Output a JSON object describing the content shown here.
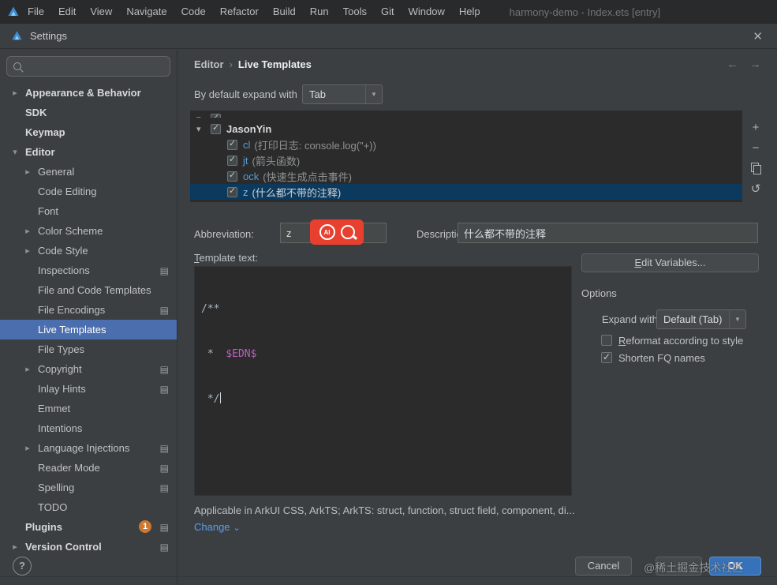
{
  "menu_bar": {
    "items": [
      "File",
      "Edit",
      "View",
      "Navigate",
      "Code",
      "Refactor",
      "Build",
      "Run",
      "Tools",
      "Git",
      "Window",
      "Help"
    ],
    "window_title": "harmony-demo - Index.ets [entry]"
  },
  "dialog": {
    "title": "Settings"
  },
  "icons": {
    "close": "✕",
    "chevron_collapsed": "▸",
    "chevron_expanded": "▾",
    "combo_arrow": "▼",
    "back": "←",
    "forward": "→",
    "breadcrumb_sep": "›",
    "tree_item": "▤",
    "add": "+",
    "remove": "−",
    "revert": "↺",
    "change_caret": "⌄",
    "help": "?"
  },
  "sidebar": {
    "items": [
      {
        "label": "Appearance & Behavior"
      },
      {
        "label": "SDK"
      },
      {
        "label": "Keymap"
      },
      {
        "label": "Editor"
      },
      {
        "label": "General"
      },
      {
        "label": "Code Editing"
      },
      {
        "label": "Font"
      },
      {
        "label": "Color Scheme"
      },
      {
        "label": "Code Style"
      },
      {
        "label": "Inspections"
      },
      {
        "label": "File and Code Templates"
      },
      {
        "label": "File Encodings"
      },
      {
        "label": "Live Templates",
        "selected": true
      },
      {
        "label": "File Types"
      },
      {
        "label": "Copyright"
      },
      {
        "label": "Inlay Hints"
      },
      {
        "label": "Emmet"
      },
      {
        "label": "Intentions"
      },
      {
        "label": "Language Injections"
      },
      {
        "label": "Reader Mode"
      },
      {
        "label": "Spelling"
      },
      {
        "label": "TODO"
      },
      {
        "label": "Plugins",
        "badge": "1"
      },
      {
        "label": "Version Control"
      }
    ]
  },
  "breadcrumb": {
    "parts": [
      "Editor",
      "Live Templates"
    ]
  },
  "main": {
    "expand_with_label": "By default expand with",
    "expand_with_value": "Tab",
    "templates": {
      "group": {
        "label": "JasonYin",
        "checked": true
      },
      "items": [
        {
          "abbr": "cl",
          "desc": "(打印日志: console.log(\"+))",
          "checked": true
        },
        {
          "abbr": "jt",
          "desc": "(箭头函数)",
          "checked": true
        },
        {
          "abbr": "ock",
          "desc": "(快速生成点击事件)",
          "checked": true
        },
        {
          "abbr": "z",
          "desc": "(什么都不带的注释)",
          "checked": true,
          "selected": true
        }
      ]
    },
    "abbreviation_label": "Abbreviation:",
    "abbreviation_value": "z",
    "annotation": {
      "ai_label": "AI"
    },
    "description_label": "Description:",
    "description_value": "什么都不带的注释",
    "template_text_label": "Template text:",
    "template_text": {
      "line1": "/**",
      "line2_prefix": " *  ",
      "line2_var": "$EDN$",
      "line3": " */"
    },
    "edit_variables_label": "Edit Variables...",
    "options_label": "Options",
    "expand_with_option_label": "Expand with",
    "expand_with_option_value": "Default (Tab)",
    "reformat_label": "Reformat according to style",
    "shorten_label": "Shorten FQ names",
    "applicable_text": "Applicable in ArkUI CSS, ArkTS; ArkTS: struct, function, struct field, component, di...",
    "change_label": "Change"
  },
  "footer": {
    "cancel_label": "Cancel",
    "ok_label": "OK",
    "watermark": "@稀土掘金技术社区"
  },
  "colors": {
    "sidebar_selection": "#4b6eaf",
    "list_selection": "#0c3a5e",
    "link_blue": "#589df6",
    "annotation_red": "#e8402f",
    "ok_button": "#3672b9",
    "template_variable": "#c05ec0",
    "abbreviation_blue": "#569cd6"
  }
}
